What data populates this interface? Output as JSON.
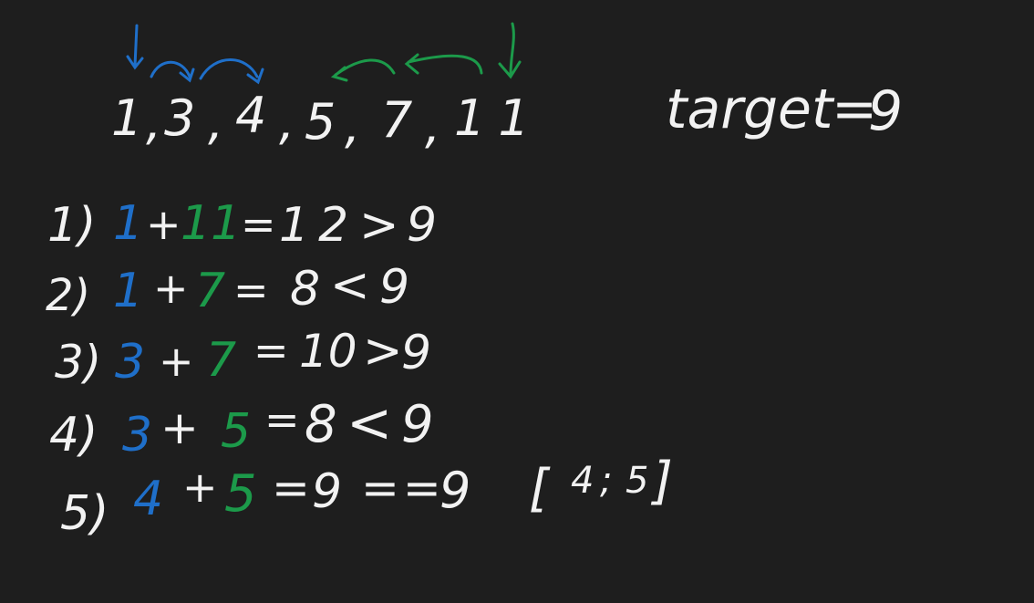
{
  "colors": {
    "background": "#1e1e1e",
    "chalk": "#f2f2f2",
    "left_pointer": "#1f6fc9",
    "right_pointer": "#1c9a4a"
  },
  "array": {
    "items": [
      "1",
      "3",
      "4",
      "5",
      "7",
      "11"
    ],
    "separator": ","
  },
  "target": {
    "label": "target",
    "eq": "=",
    "value": "9"
  },
  "steps": [
    {
      "num": "1)",
      "a": "1",
      "op": "+",
      "b": "11",
      "eq": "=",
      "sum": "12",
      "cmp": ">",
      "t": "9"
    },
    {
      "num": "2)",
      "a": "1",
      "op": "+",
      "b": "7",
      "eq": "=",
      "sum": "8",
      "cmp": "<",
      "t": "9"
    },
    {
      "num": "3)",
      "a": "3",
      "op": "+",
      "b": "7",
      "eq": "=",
      "sum": "10",
      "cmp": ">",
      "t": "9"
    },
    {
      "num": "4)",
      "a": "3",
      "op": "+",
      "b": "5",
      "eq": "=",
      "sum": "8",
      "cmp": "<",
      "t": "9"
    },
    {
      "num": "5)",
      "a": "4",
      "op": "+",
      "b": "5",
      "eq": "=",
      "sum": "9",
      "cmp": "==",
      "t": "9"
    }
  ],
  "answer": {
    "open": "[",
    "first": "4",
    "sep": ";",
    "second": "5",
    "close": "]"
  }
}
